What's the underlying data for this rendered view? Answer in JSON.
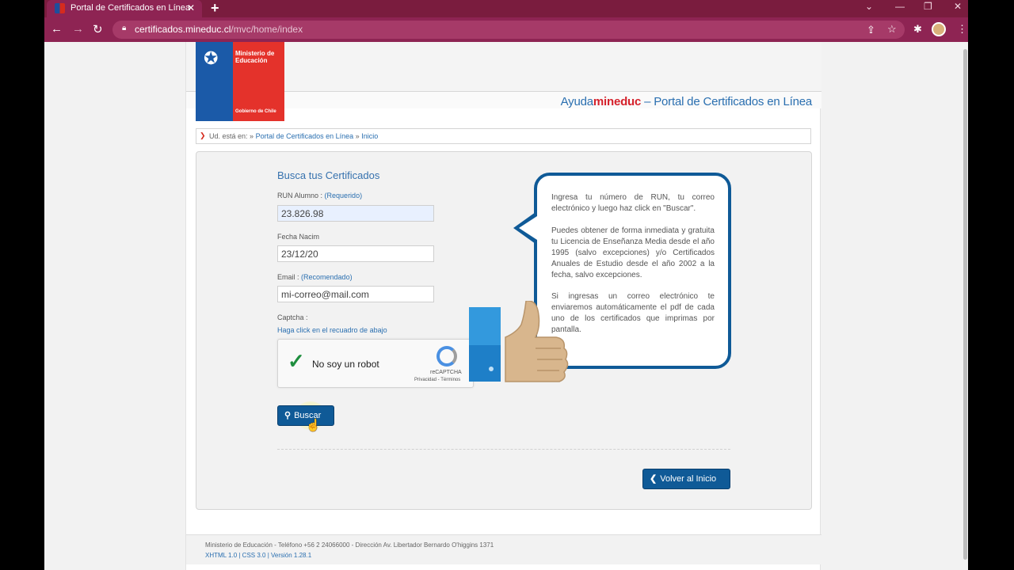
{
  "browser": {
    "tab_title": "Portal de Certificados en Línea",
    "tab_close": "✕",
    "new_tab": "+",
    "url_host": "certificados.mineduc.cl",
    "url_path": "/mvc/home/index",
    "window_controls": [
      "⌄",
      "—",
      "❐",
      "✕"
    ]
  },
  "header": {
    "logo_ministerio": "Ministerio de Educación",
    "logo_gobierno": "Gobierno de Chile",
    "brand_prefix": "Ayuda",
    "brand_red": "mineduc",
    "brand_suffix": " – Portal de Certificados en Línea"
  },
  "breadcrumb": {
    "prefix": "Ud. está en: »",
    "link1": "Portal de Certificados en Línea",
    "sep": "»",
    "link2": "Inicio"
  },
  "form": {
    "title": "Busca tus Certificados",
    "run_label": "RUN Alumno :",
    "run_hint": "(Requerido)",
    "run_value": "23.826.98",
    "fecha_label": "Fecha Nacim",
    "fecha_value": "23/12/20",
    "email_label": "Email :",
    "email_hint": "(Recomendado)",
    "email_placeholder": "mi-correo@mail.com",
    "captcha_label": "Captcha :",
    "captcha_hint": "Haga click en el recuadro de abajo",
    "recaptcha_label": "No soy un robot",
    "recaptcha_brand": "reCAPTCHA",
    "recaptcha_terms": "Privacidad - Términos",
    "buscar_label": "Buscar",
    "volver_label": "Volver al Inicio"
  },
  "info": {
    "p1": "Ingresa tu número de RUN, tu correo electrónico y luego haz click en \"Buscar\".",
    "p2": "Puedes obtener de forma inmediata y gratuita tu Licencia de Enseñanza Media desde el año 1995 (salvo excepciones) y/o Certificados Anuales de Estudio desde el año 2002 a la fecha, salvo excepciones.",
    "p3": "Si ingresas un correo electrónico te enviaremos automáticamente el pdf de cada uno de los certificados que imprimas por pantalla."
  },
  "footer": {
    "line1": "Ministerio de Educación - Teléfono +56 2 24066000 - Dirección Av. Libertador Bernardo O'higgins 1371",
    "line2": "XHTML 1.0 | CSS 3.0 | Versión 1.28.1"
  },
  "colors": {
    "chrome": "#8e2453",
    "primary_blue": "#0f5a97",
    "brand_red": "#d5212b"
  }
}
